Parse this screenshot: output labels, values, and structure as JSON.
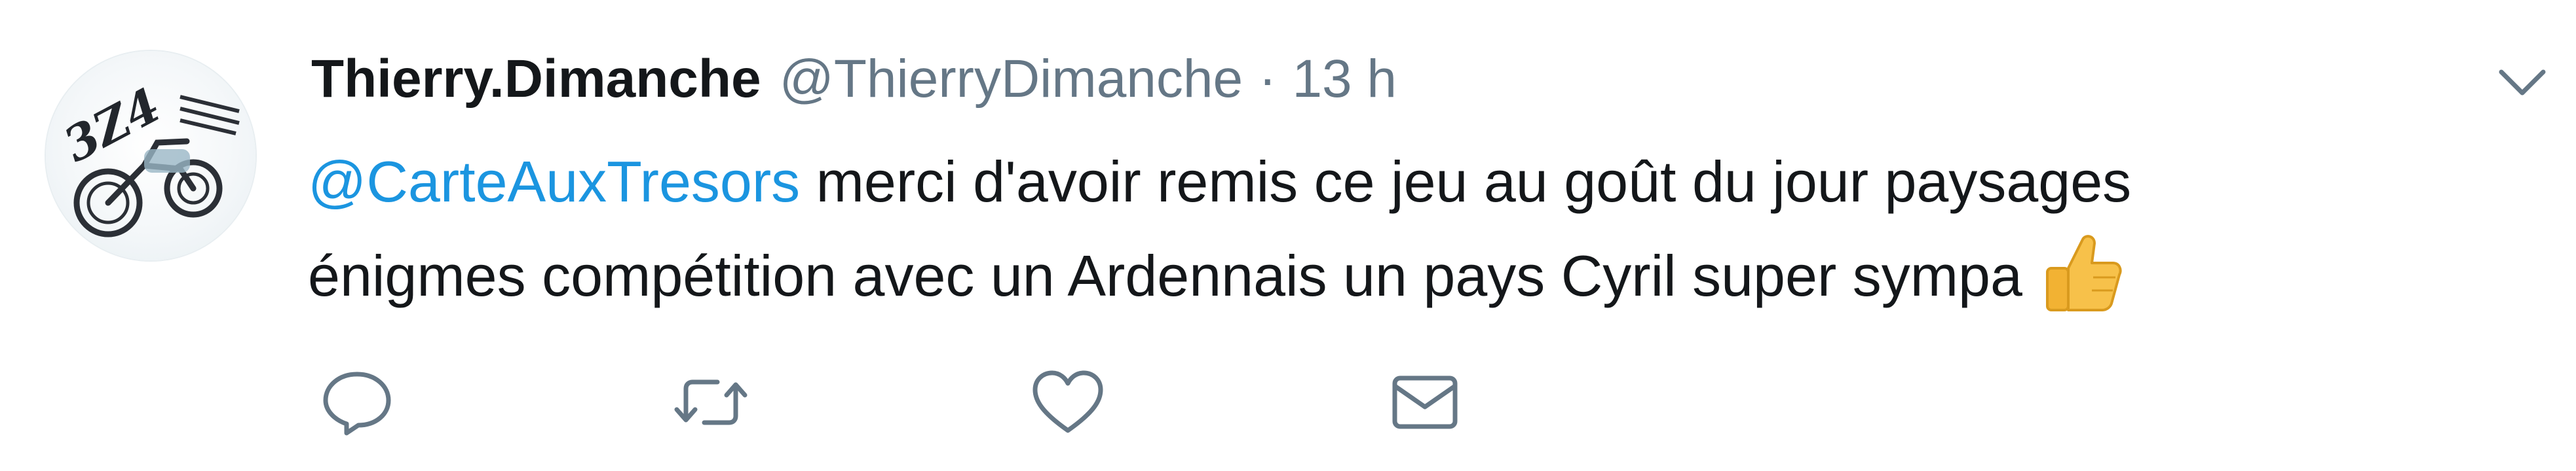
{
  "tweet": {
    "display_name": "Thierry.Dimanche",
    "handle": "@ThierryDimanche",
    "separator": "·",
    "timestamp": "13 h",
    "mention": "@CarteAuxTresors",
    "text_line1": " merci d'avoir remis ce jeu au goût du jour paysages",
    "text_line2": "énigmes compétition avec un Ardennais un pays Cyril super sympa",
    "avatar_text": "3Z4"
  },
  "icons": {
    "caret": "chevron-down-icon",
    "emoji": "thumbs-up-icon",
    "reply": "reply-icon",
    "retweet": "retweet-icon",
    "like": "heart-icon",
    "dm": "envelope-icon"
  },
  "colors": {
    "link": "#1b95e0",
    "text": "#14171a",
    "secondary": "#657786",
    "icon": "#657786",
    "emoji": "#f7c14a"
  }
}
